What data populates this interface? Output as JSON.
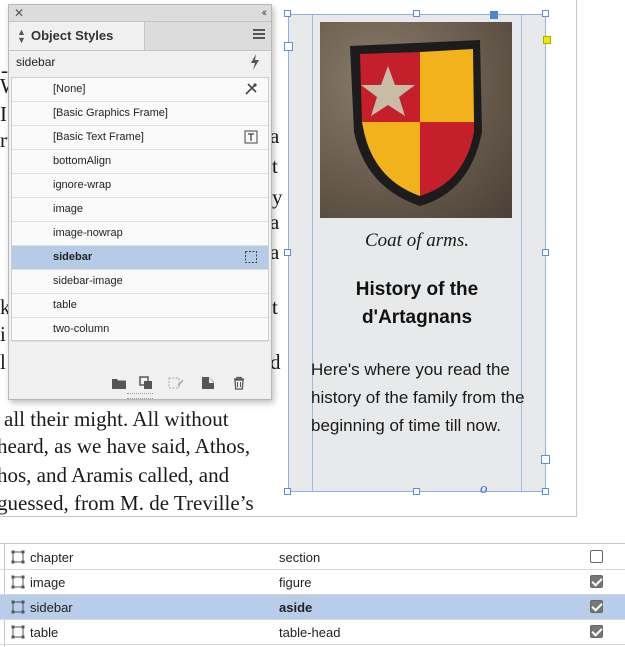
{
  "document": {
    "body_lines": [
      "all their might. All without",
      "heard, as we have said, Athos,",
      "hos, and Aramis called, and",
      "guessed, from M. de Treville’s"
    ],
    "hidden_fragments": [
      "-",
      "W",
      "I",
      "rt",
      "a",
      "t",
      "y",
      "a",
      "a",
      "k",
      "t",
      "i",
      "l",
      "d"
    ],
    "sidebar": {
      "caption": "Coat of arms.",
      "title_line1": "History of the",
      "title_line2": "d'Artagnans",
      "text": "Here's where you read the history of the family from the beginning of time till now.",
      "overset_mark": "o"
    }
  },
  "panel": {
    "title": "Object Styles",
    "current_style": "sidebar",
    "styles": [
      {
        "label": "[None]",
        "icon": "none-style-icon"
      },
      {
        "label": "[Basic Graphics Frame]",
        "icon": ""
      },
      {
        "label": "[Basic Text Frame]",
        "icon": "text-frame-icon"
      },
      {
        "label": "bottomAlign",
        "icon": ""
      },
      {
        "label": "ignore-wrap",
        "icon": ""
      },
      {
        "label": "image",
        "icon": ""
      },
      {
        "label": "image-nowrap",
        "icon": ""
      },
      {
        "label": "sidebar",
        "icon": "frame-style-icon",
        "selected": true
      },
      {
        "label": "sidebar-image",
        "icon": ""
      },
      {
        "label": "table",
        "icon": ""
      },
      {
        "label": "two-column",
        "icon": ""
      }
    ]
  },
  "tag_map": {
    "rows": [
      {
        "style": "chapter",
        "tag": "section",
        "checked": false
      },
      {
        "style": "image",
        "tag": "figure",
        "checked": true
      },
      {
        "style": "sidebar",
        "tag": "aside",
        "checked": true,
        "selected": true
      },
      {
        "style": "table",
        "tag": "table-head",
        "checked": true
      }
    ]
  },
  "colors": {
    "selection": "#b5cbe6",
    "frame_guide": "#8fb1e0",
    "shield_red": "#c41f2a",
    "shield_yellow": "#f2b21b",
    "star": "#c8bca6"
  }
}
